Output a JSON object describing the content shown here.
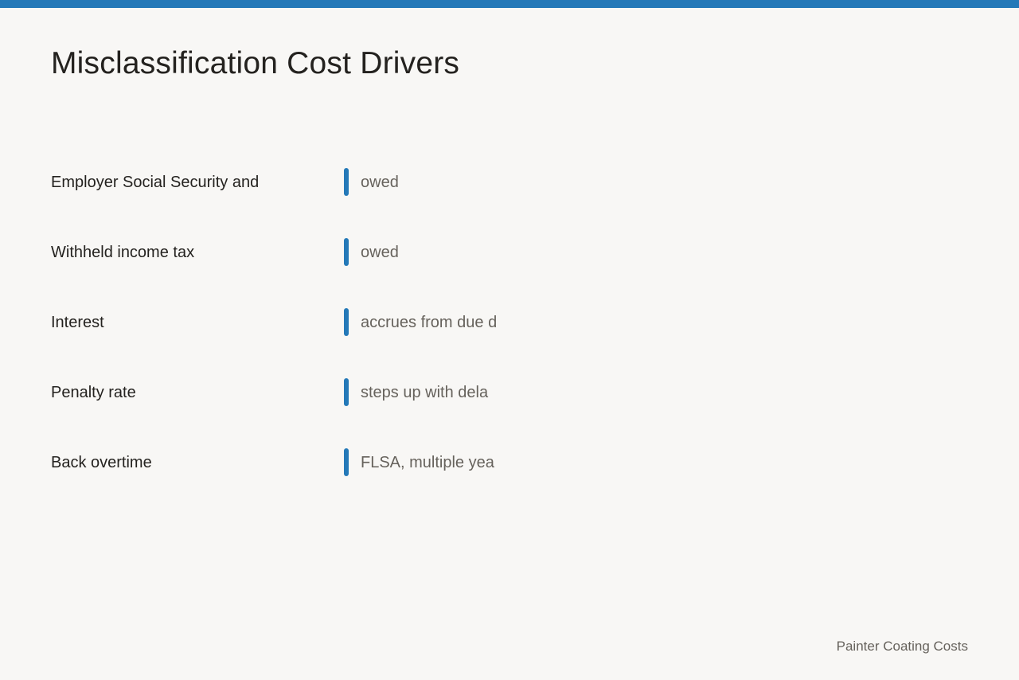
{
  "title": "Misclassification Cost Drivers",
  "rows": [
    {
      "label": "Employer Social Security and",
      "value": "owed"
    },
    {
      "label": "Withheld income tax",
      "value": "owed"
    },
    {
      "label": "Interest",
      "value": "accrues from due d"
    },
    {
      "label": "Penalty rate",
      "value": "steps up with dela"
    },
    {
      "label": "Back overtime",
      "value": "FLSA, multiple yea"
    }
  ],
  "footer": "Painter Coating Costs",
  "colors": {
    "accent": "#2479b8",
    "background": "#f8f7f5",
    "text": "#24221f",
    "muted_text": "#66625c"
  }
}
